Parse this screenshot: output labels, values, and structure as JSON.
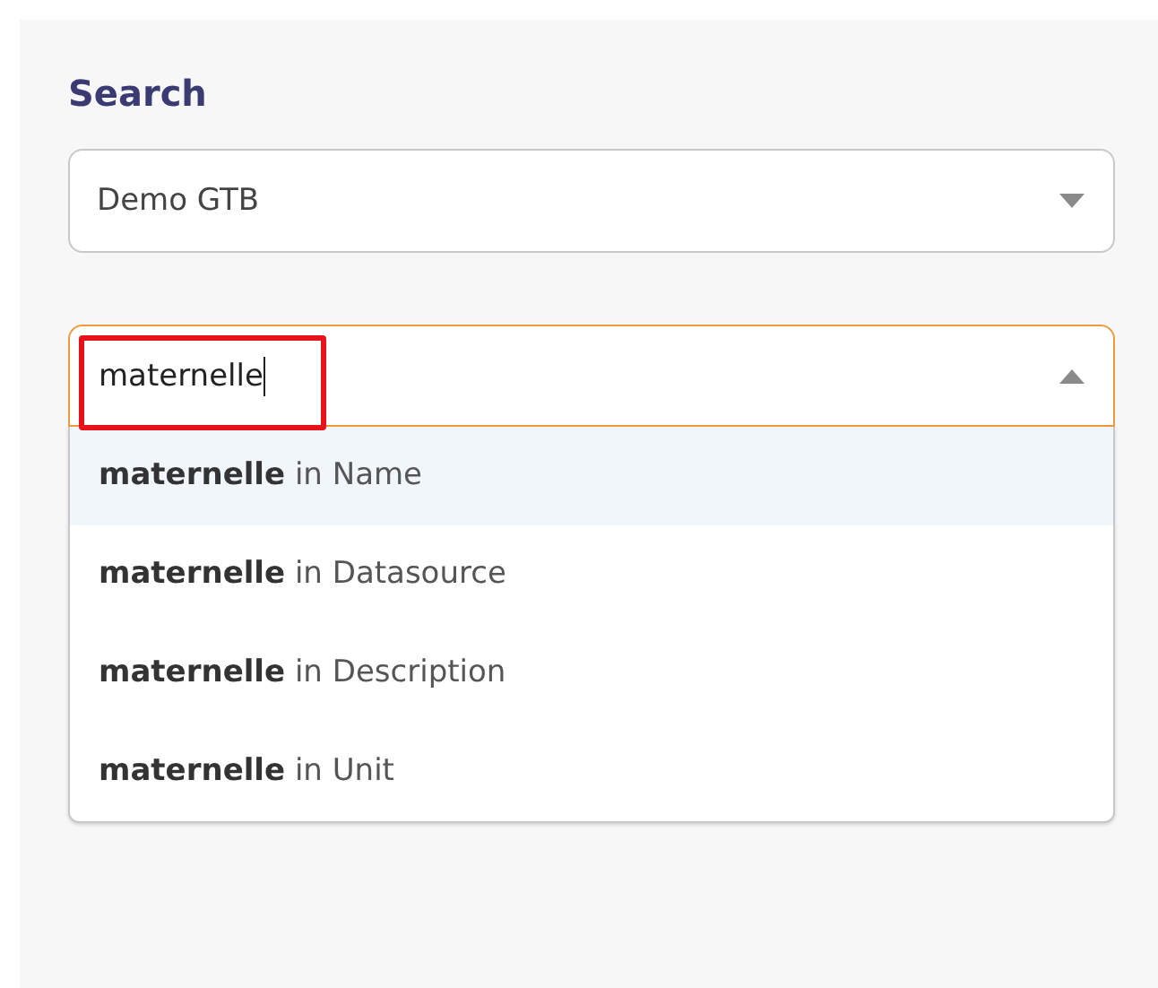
{
  "heading": "Search",
  "source_select": {
    "value": "Demo GTB",
    "open": false
  },
  "search_field": {
    "value": "maternelle",
    "focused": true,
    "highlighted": true,
    "open": true
  },
  "suggestions": [
    {
      "text": "**maternelle** in Name",
      "selected": true
    },
    {
      "text": "**maternelle** in Datasource",
      "selected": false
    },
    {
      "text": "**maternelle** in Description",
      "selected": false
    },
    {
      "text": "**maternelle** in Unit",
      "selected": false
    }
  ]
}
